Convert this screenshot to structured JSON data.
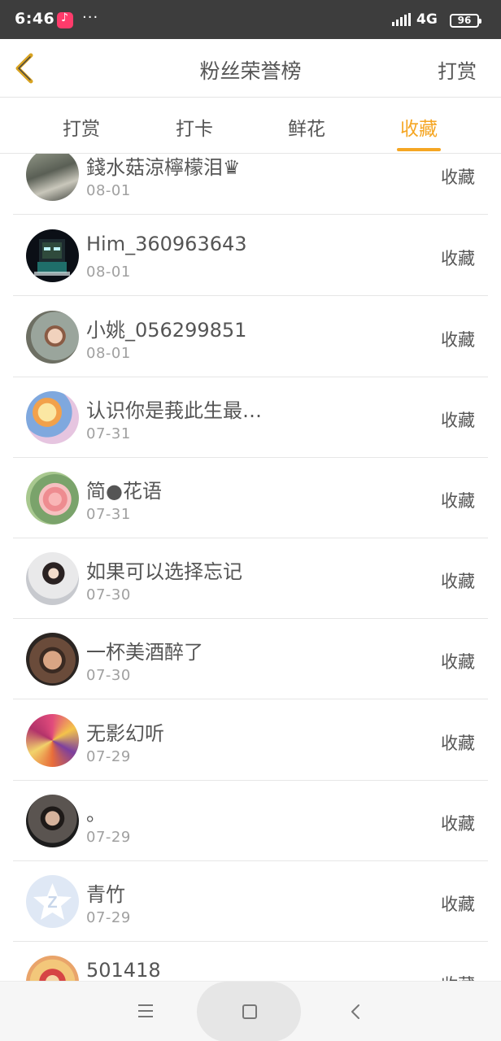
{
  "status_bar": {
    "time": "6:46",
    "dots": "···",
    "network": "4G",
    "battery": "96"
  },
  "header": {
    "title": "粉丝荣誉榜",
    "action_label": "打赏"
  },
  "tabs": [
    {
      "label": "打赏",
      "active": false
    },
    {
      "label": "打卡",
      "active": false
    },
    {
      "label": "鲜花",
      "active": false
    },
    {
      "label": "收藏",
      "active": true
    }
  ],
  "colors": {
    "accent": "#f5a623",
    "text": "#555555",
    "date": "#a0a0a0",
    "divider": "#e6e6e6"
  },
  "list": [
    {
      "name": "錢水菇涼檸檬泪♛",
      "date": "08-01",
      "action": "收藏",
      "avatar": "photo-avatar"
    },
    {
      "name": "Him_360963643",
      "date": "08-01",
      "action": "收藏",
      "avatar": "pixel-character-avatar"
    },
    {
      "name": "小姚_056299851",
      "date": "08-01",
      "action": "收藏",
      "avatar": "child-photo-avatar"
    },
    {
      "name": "认识你是莪此生最…",
      "date": "07-31",
      "action": "收藏",
      "avatar": "anime-avatar"
    },
    {
      "name": "简●花语",
      "date": "07-31",
      "action": "收藏",
      "avatar": "flower-avatar"
    },
    {
      "name": "如果可以选择忘记",
      "date": "07-30",
      "action": "收藏",
      "avatar": "girl-photo-avatar"
    },
    {
      "name": "一杯美酒醉了",
      "date": "07-30",
      "action": "收藏",
      "avatar": "man-photo-avatar"
    },
    {
      "name": "无影幻听",
      "date": "07-29",
      "action": "收藏",
      "avatar": "colorful-art-avatar"
    },
    {
      "name": "。",
      "date": "07-29",
      "action": "收藏",
      "avatar": "man-portrait-avatar"
    },
    {
      "name": "青竹",
      "date": "07-29",
      "action": "收藏",
      "avatar": "qq-default-avatar"
    },
    {
      "name": "501418",
      "date": "",
      "action": "收藏",
      "avatar": "anime-avatar"
    }
  ]
}
